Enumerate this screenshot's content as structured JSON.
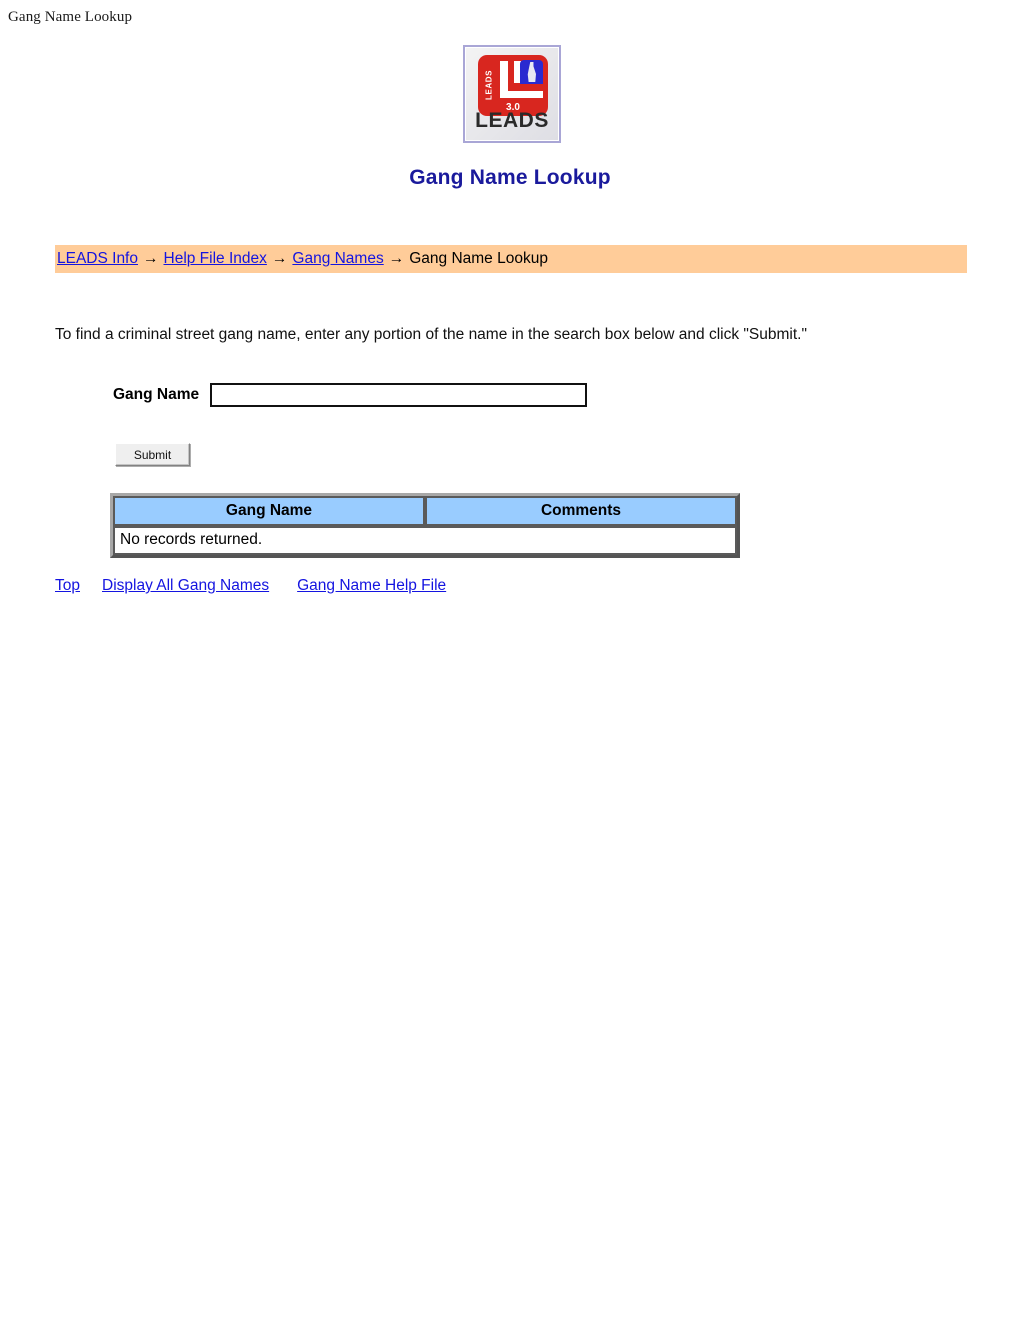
{
  "document": {
    "browser_header": "Gang Name Lookup",
    "page_title": "Gang Name Lookup"
  },
  "logo": {
    "name": "leads-logo",
    "wordmark": "LEADS",
    "side_text": "LEADS",
    "version": "3.0"
  },
  "breadcrumb": {
    "items": [
      {
        "label": "LEADS Info",
        "is_link": true
      },
      {
        "label": "Help File Index",
        "is_link": true
      },
      {
        "label": "Gang Names",
        "is_link": true
      },
      {
        "label": "Gang Name Lookup",
        "is_link": false
      }
    ],
    "separator": "→",
    "background_color": "#FFCC99"
  },
  "instruction": {
    "text": "To find a criminal street gang name, enter any portion of the name in the search box below and click \"Submit.\""
  },
  "form": {
    "label": "Gang Name",
    "input_value": "",
    "input_placeholder": "",
    "submit_label": "Submit"
  },
  "results": {
    "headers": [
      "Gang Name",
      "Comments"
    ],
    "empty_message": "No records returned.",
    "header_color": "#99CCFF"
  },
  "footer": {
    "links": [
      {
        "label": "Top"
      },
      {
        "label": "Display All Gang Names"
      },
      {
        "label": "Gang Name Help File"
      }
    ]
  },
  "theme": {
    "link_color": "#1414E0",
    "title_color": "#1A1A9C",
    "accent_peach": "#FFCC99",
    "accent_blue": "#99CCFF"
  }
}
